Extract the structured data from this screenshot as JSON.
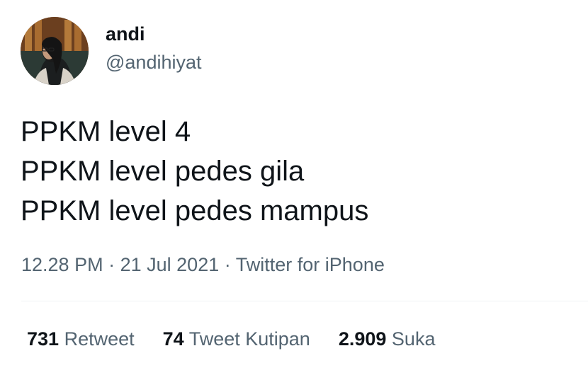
{
  "author": {
    "display_name": "andi",
    "handle": "@andihiyat"
  },
  "tweet": {
    "lines": [
      "PPKM level 4",
      "PPKM level pedes gila",
      "PPKM level pedes mampus"
    ],
    "time": "12.28 PM",
    "separator": "·",
    "date": "21 Jul 2021",
    "source": "Twitter for iPhone"
  },
  "stats": {
    "retweets": {
      "count": "731",
      "label": "Retweet"
    },
    "quotes": {
      "count": "74",
      "label": "Tweet Kutipan"
    },
    "likes": {
      "count": "2.909",
      "label": "Suka"
    }
  },
  "colors": {
    "text_primary": "#0f1419",
    "text_secondary": "#536471",
    "divider": "#eff3f4"
  }
}
